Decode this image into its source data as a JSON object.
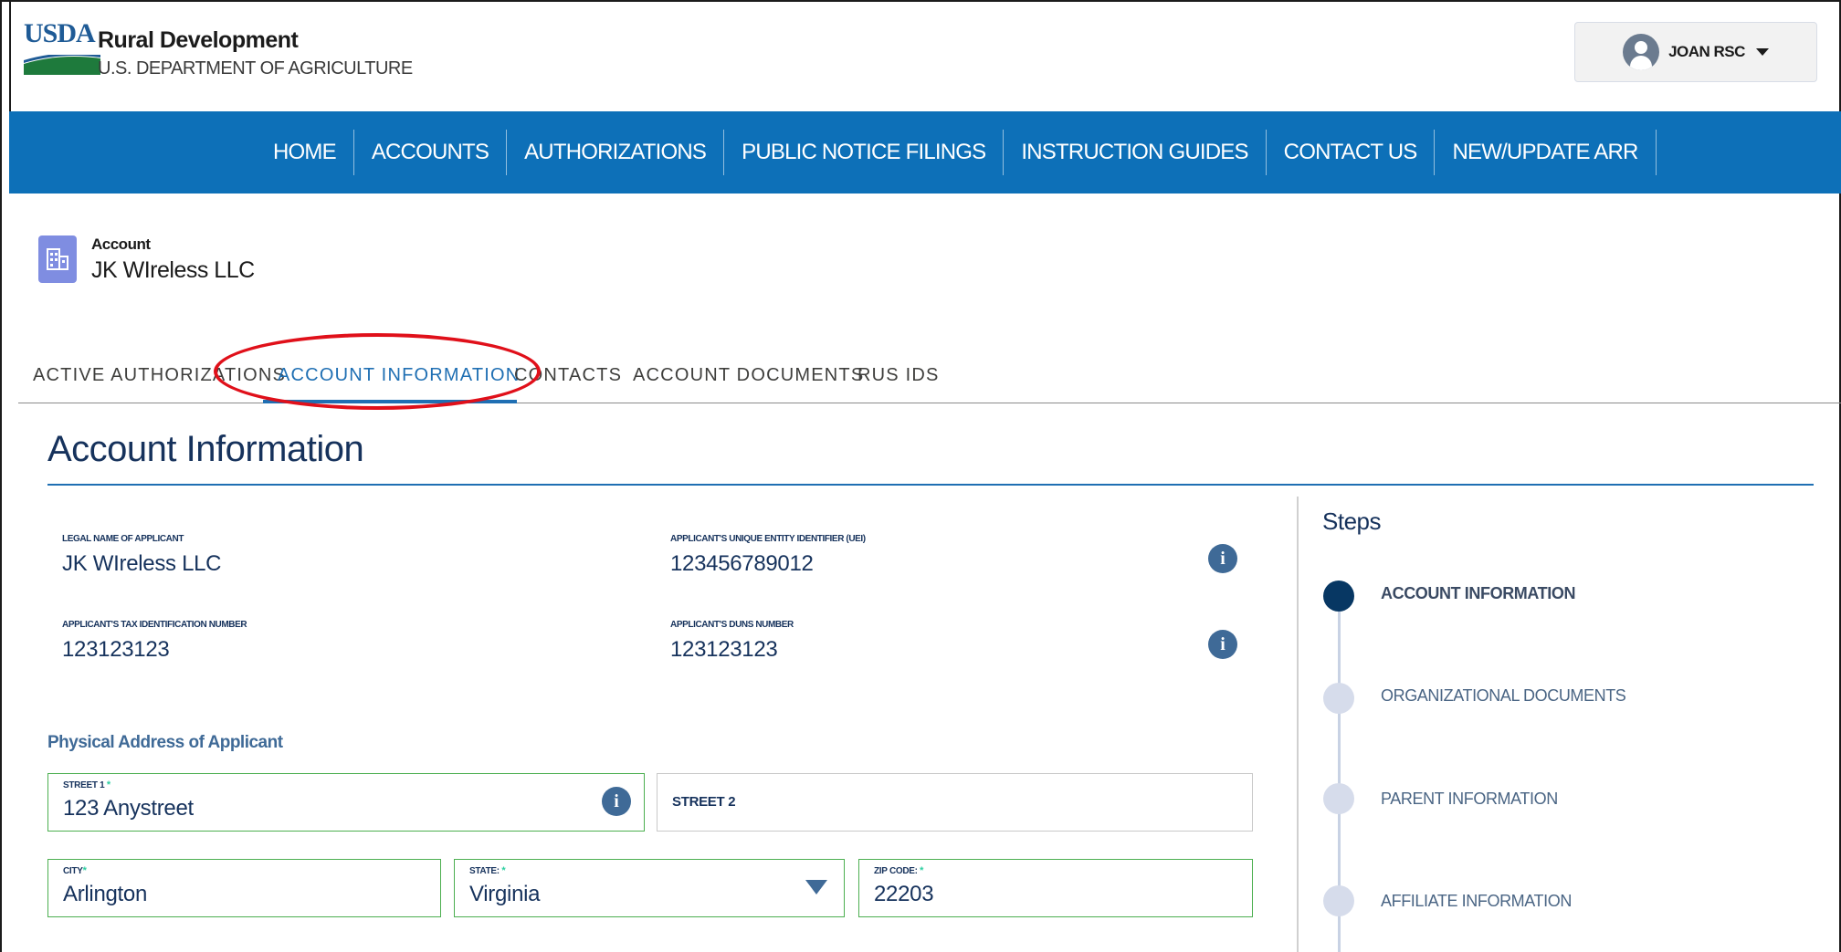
{
  "header": {
    "logo_text": "USDA",
    "agency_title": "Rural Development",
    "agency_subtitle": "U.S. DEPARTMENT OF AGRICULTURE",
    "user_name": "JOAN RSC"
  },
  "nav": {
    "items": [
      "HOME",
      "ACCOUNTS",
      "AUTHORIZATIONS",
      "PUBLIC NOTICE FILINGS",
      "INSTRUCTION GUIDES",
      "CONTACT US",
      "NEW/UPDATE ARR"
    ]
  },
  "account": {
    "label": "Account",
    "name": "JK WIreless LLC"
  },
  "tabs": {
    "items": [
      "ACTIVE AUTHORIZATIONS",
      "ACCOUNT INFORMATION",
      "CONTACTS",
      "ACCOUNT DOCUMENTS",
      "RUS IDS"
    ],
    "active": "ACCOUNT INFORMATION"
  },
  "section": {
    "title": "Account Information"
  },
  "fields": {
    "legal_name_label": "LEGAL NAME OF APPLICANT",
    "legal_name_value": "JK WIreless LLC",
    "uei_label": "APPLICANT'S UNIQUE ENTITY IDENTIFIER (UEI)",
    "uei_value": "123456789012",
    "tin_label": "APPLICANT'S TAX IDENTIFICATION NUMBER",
    "tin_value": "123123123",
    "duns_label": "APPLICANT'S DUNS NUMBER",
    "duns_value": "123123123",
    "info_glyph": "i"
  },
  "address": {
    "heading": "Physical Address of Applicant",
    "street1_label": "STREET 1",
    "street1_value": "123 Anystreet",
    "street2_label": "STREET 2",
    "city_label": "CITY",
    "city_value": "Arlington",
    "state_label": "STATE:",
    "state_value": "Virginia",
    "zip_label": "ZIP CODE:",
    "zip_value": "22203",
    "required_marker": "*"
  },
  "steps": {
    "title": "Steps",
    "items": [
      "ACCOUNT INFORMATION",
      "ORGANIZATIONAL DOCUMENTS",
      "PARENT INFORMATION",
      "AFFILIATE INFORMATION"
    ],
    "current": "ACCOUNT INFORMATION"
  },
  "colors": {
    "nav_blue": "#0d70b8",
    "accent_blue": "#1f6fb3",
    "annotation_red": "#e0101a",
    "required_green": "#4caf50",
    "account_icon": "#7f8de1"
  },
  "icons": {
    "account": "building-icon",
    "user": "user-avatar-icon",
    "dropdown": "caret-down-icon",
    "info": "info-icon"
  }
}
